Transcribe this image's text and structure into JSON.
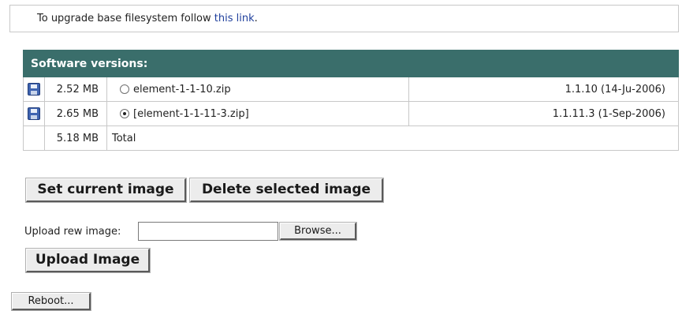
{
  "notice": {
    "prefix": "To upgrade base filesystem follow",
    "link": "this link",
    "suffix": "."
  },
  "versions": {
    "header": "Software versions:",
    "rows": [
      {
        "icon": "floppy-disk-icon",
        "size": "2.52 MB",
        "selected": false,
        "file": "element-1-1-10.zip",
        "version": "1.1.10 (14-Ju-2006)"
      },
      {
        "icon": "floppy-disk-icon",
        "size": "2.65 MB",
        "selected": true,
        "file": "[element-1-1-11-3.zip]",
        "version": "1.1.11.3 (1-Sep-2006)"
      }
    ],
    "total": {
      "size": "5.18 MB",
      "label": "Total"
    }
  },
  "buttons": {
    "set_current": "Set current image",
    "delete_selected": "Delete selected image",
    "browse": "Browse...",
    "upload": "Upload Image",
    "reboot": "Reboot..."
  },
  "upload": {
    "label": "Upload rew image:",
    "value": ""
  },
  "colors": {
    "header_bg": "#3a6e6b",
    "link": "#1f3f9c"
  }
}
